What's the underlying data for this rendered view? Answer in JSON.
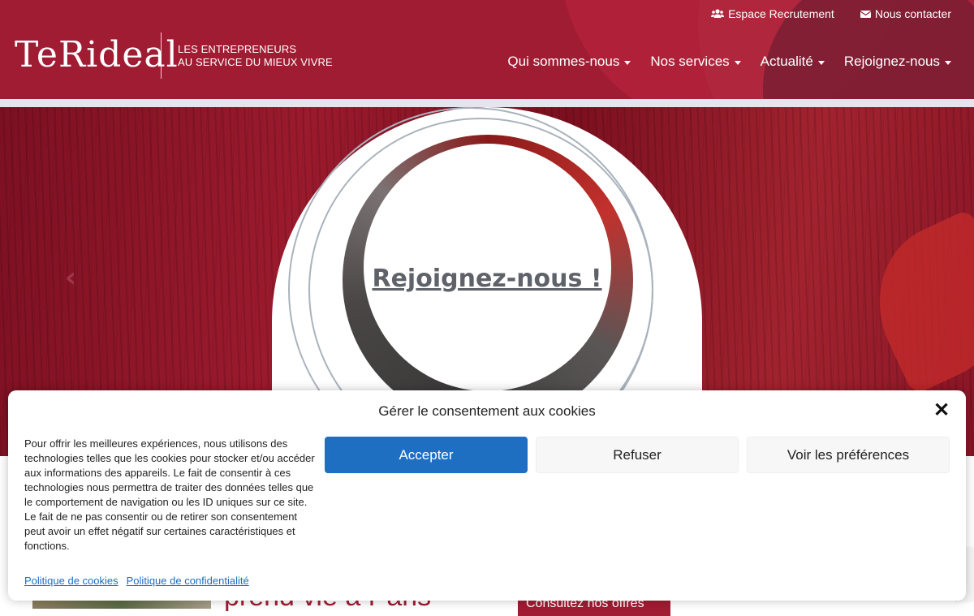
{
  "header": {
    "logo_text": "TeRideal",
    "tagline_line1": "LES ENTREPRENEURS",
    "tagline_line2": "AU SERVICE DU MIEUX VIVRE",
    "top_links": [
      {
        "label": "Espace Recrutement",
        "icon": "users-icon"
      },
      {
        "label": "Nous contacter",
        "icon": "envelope-icon"
      }
    ],
    "nav": [
      {
        "label": "Qui sommes-nous"
      },
      {
        "label": "Nos services"
      },
      {
        "label": "Actualité"
      },
      {
        "label": "Rejoignez-nous"
      }
    ],
    "colors": {
      "brand": "#a01c33"
    }
  },
  "hero": {
    "link_text": "Rejoignez-nous !",
    "prev_icon": "chevron-left-icon"
  },
  "below": {
    "headline_peek": "prend vie à Paris",
    "button_peek": "Consultez nos offres"
  },
  "cookie": {
    "title": "Gérer le consentement aux cookies",
    "close_icon": "close-icon",
    "text": "Pour offrir les meilleures expériences, nous utilisons des technologies telles que les cookies pour stocker et/ou accéder aux informations des appareils. Le fait de consentir à ces technologies nous permettra de traiter des données telles que le comportement de navigation ou les ID uniques sur ce site. Le fait de ne pas consentir ou de retirer son consentement peut avoir un effet négatif sur certaines caractéristiques et fonctions.",
    "accept_label": "Accepter",
    "refuse_label": "Refuser",
    "prefs_label": "Voir les préférences",
    "cookie_policy_link": "Politique de cookies",
    "privacy_policy_link": "Politique de confidentialité",
    "colors": {
      "accept": "#1e6ec1"
    }
  }
}
